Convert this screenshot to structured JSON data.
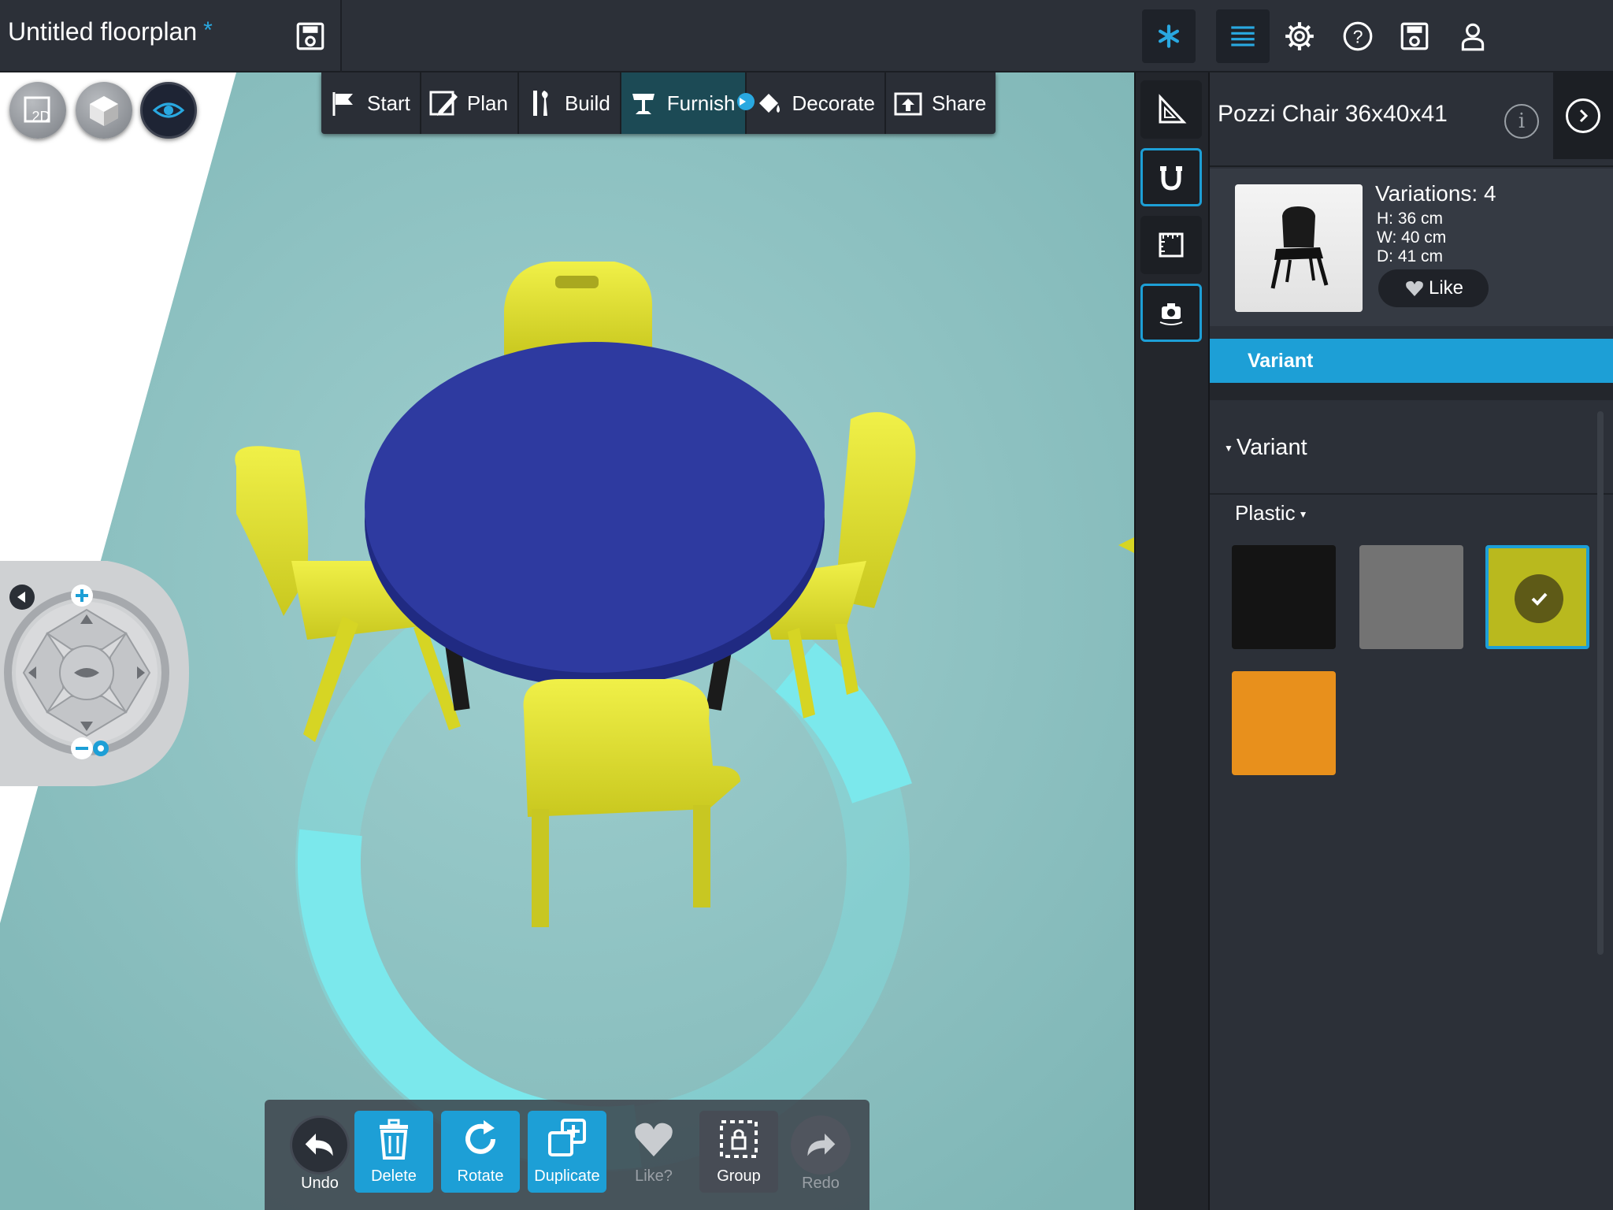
{
  "app": {
    "title": "Untitled floorplan",
    "unsaved_marker": "*"
  },
  "mode_tabs": [
    {
      "label": "Start",
      "icon": "flag-icon"
    },
    {
      "label": "Plan",
      "icon": "pencil-icon"
    },
    {
      "label": "Build",
      "icon": "tools-icon"
    },
    {
      "label": "Furnish",
      "icon": "chair-icon",
      "active": true
    },
    {
      "label": "Decorate",
      "icon": "paint-bucket-icon"
    },
    {
      "label": "Share",
      "icon": "upload-icon"
    }
  ],
  "view_buttons": {
    "two_d": "2D",
    "three_d_icon": "cube-icon",
    "eye_icon": "eye-icon"
  },
  "actions": [
    {
      "label": "Undo",
      "icon": "undo-icon"
    },
    {
      "label": "Delete",
      "icon": "trash-icon"
    },
    {
      "label": "Rotate",
      "icon": "rotate-icon"
    },
    {
      "label": "Duplicate",
      "icon": "duplicate-icon"
    },
    {
      "label": "Like?",
      "icon": "heart-icon",
      "disabled": true
    },
    {
      "label": "Group",
      "icon": "group-icon"
    },
    {
      "label": "Redo",
      "icon": "redo-icon",
      "disabled": true
    }
  ],
  "product": {
    "title": "Pozzi Chair 36x40x41",
    "variations": "Variations: 4",
    "height": "H: 36 cm",
    "width": "W: 40 cm",
    "depth": "D: 41 cm",
    "like_label": "Like"
  },
  "variant_tab": "Variant",
  "variant_section": "Variant",
  "material_group": "Plastic",
  "swatches": [
    {
      "name": "black",
      "color": "#141414"
    },
    {
      "name": "gray",
      "color": "#737373"
    },
    {
      "name": "yellow",
      "color": "#b9b91e",
      "selected": true
    },
    {
      "name": "orange",
      "color": "#e8901c"
    }
  ],
  "colors": {
    "accent": "#1d9fd6",
    "floor": "#8fc5c5",
    "table_top": "#2e3aa0",
    "chairs": "#e6e62a",
    "rotation_ring": "#7be8ec"
  }
}
